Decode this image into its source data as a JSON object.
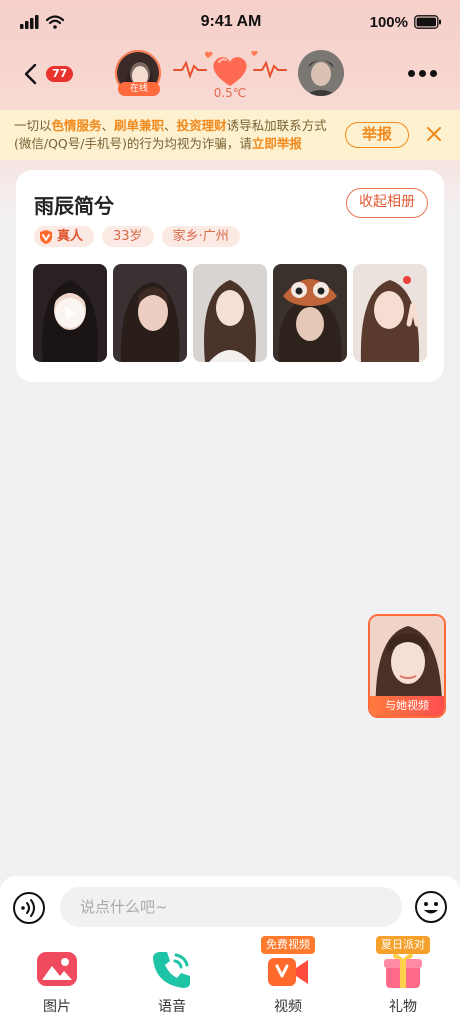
{
  "status_bar": {
    "time": "9:41 AM",
    "battery": "100%"
  },
  "nav": {
    "unread_count": "77",
    "online_label": "在线",
    "temperature": "0.5℃"
  },
  "warning": {
    "parts": [
      {
        "t": "一切以",
        "hl": false
      },
      {
        "t": "色情服务",
        "hl": true
      },
      {
        "t": "、",
        "hl": false
      },
      {
        "t": "刷单兼职",
        "hl": true
      },
      {
        "t": "、",
        "hl": false
      },
      {
        "t": "投资理财",
        "hl": true
      },
      {
        "t": "诱导私加联系方式(微信/QQ号/手机号)的行为均视为诈骗，请",
        "hl": false
      },
      {
        "t": "立即举报",
        "hl": true
      }
    ],
    "report_label": "举报"
  },
  "profile": {
    "name": "雨辰简兮",
    "collapse_label": "收起相册",
    "tags": {
      "real": "真人",
      "age": "33岁",
      "hometown": "家乡·广州"
    }
  },
  "video_float": {
    "label": "与她视频"
  },
  "input": {
    "placeholder": "说点什么吧~"
  },
  "tabs": [
    {
      "label": "图片"
    },
    {
      "label": "语音"
    },
    {
      "label": "视频",
      "badge": "免费视频"
    },
    {
      "label": "礼物",
      "badge": "夏日派对"
    }
  ],
  "colors": {
    "accent": "#ff6a3d",
    "warning_bg": "#fdf1cf",
    "highlight": "#f08a1f"
  }
}
